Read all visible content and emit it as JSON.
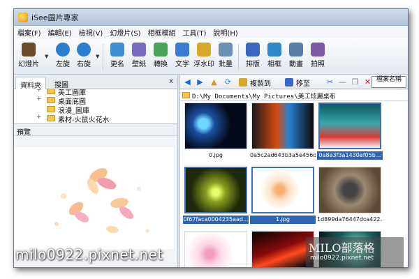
{
  "window": {
    "title": "iSee圖片專家"
  },
  "menu": [
    "檔案(F)",
    "編輯(E)",
    "檢視(V)",
    "幻燈片(S)",
    "相框模組",
    "工具(T)",
    "說明(H)"
  ],
  "toolbar": {
    "buttons": [
      {
        "label": "幻燈片",
        "icon": "slideshow-icon",
        "color": "#6b4a2a"
      },
      {
        "label": "左旋",
        "icon": "rotate-left-icon",
        "color": "#2a7fd0"
      },
      {
        "label": "右旋",
        "icon": "rotate-right-icon",
        "color": "#2a7fd0"
      },
      {
        "label": "更名",
        "icon": "rename-icon",
        "color": "#3d8fd6"
      },
      {
        "label": "壁紙",
        "icon": "wallpaper-icon",
        "color": "#7a6cc0"
      },
      {
        "label": "轉換",
        "icon": "convert-icon",
        "color": "#4aa35a"
      },
      {
        "label": "文字",
        "icon": "text-icon",
        "color": "#3a7bd5"
      },
      {
        "label": "浮水印",
        "icon": "watermark-icon",
        "color": "#d8a72a"
      },
      {
        "label": "批量",
        "icon": "batch-icon",
        "color": "#6c8fb8"
      },
      {
        "label": "排版",
        "icon": "layout-icon",
        "color": "#3b66c4"
      },
      {
        "label": "相框",
        "icon": "frame-icon",
        "color": "#2f88c9"
      },
      {
        "label": "動畫",
        "icon": "animation-icon",
        "color": "#5a7ea6"
      },
      {
        "label": "拍照",
        "icon": "camera-icon",
        "color": "#7b5aa6"
      }
    ]
  },
  "left_tabs": {
    "folder_tab": "資料夾",
    "favorites_tab": "搜圖",
    "close": "x"
  },
  "tree": [
    {
      "text": "美工圖庫",
      "expander": "+"
    },
    {
      "text": "桌面底圖",
      "expander": "+"
    },
    {
      "text": "浪漫_圖庫",
      "expander": ""
    },
    {
      "text": "素材-火鼠火花水",
      "expander": "+"
    }
  ],
  "preview": {
    "label": "預覽"
  },
  "right_toolbar": {
    "copy_to": "複製到",
    "move_to": "移至",
    "sort": "檔案名稱"
  },
  "path": "D:\\My Documents\\My Pictures\\美工炫麗桌布",
  "thumbnails": [
    {
      "caption": "0.jpg",
      "selected": false,
      "kind": "space"
    },
    {
      "caption": "0a5c2ad643b3a5e456d...",
      "selected": false,
      "kind": "firewater"
    },
    {
      "caption": "0a8e3f3a1430ef05b...",
      "selected": true,
      "kind": "cloud"
    },
    {
      "caption": "0f67faca0004235aad...",
      "selected": true,
      "kind": "chrome"
    },
    {
      "caption": "1.jpg",
      "selected": true,
      "kind": "flower"
    },
    {
      "caption": "1d899da76447dca422...",
      "selected": false,
      "kind": "headphone"
    },
    {
      "caption": "",
      "selected": false,
      "kind": "pinkflower"
    },
    {
      "caption": "",
      "selected": false,
      "kind": "redwave"
    },
    {
      "caption": "",
      "selected": false,
      "kind": "teal"
    }
  ],
  "watermarks": {
    "left": "milo0922.pixnet.net",
    "right_title": "MILO部落格",
    "right_url": "milo0922.pixnet.net"
  }
}
